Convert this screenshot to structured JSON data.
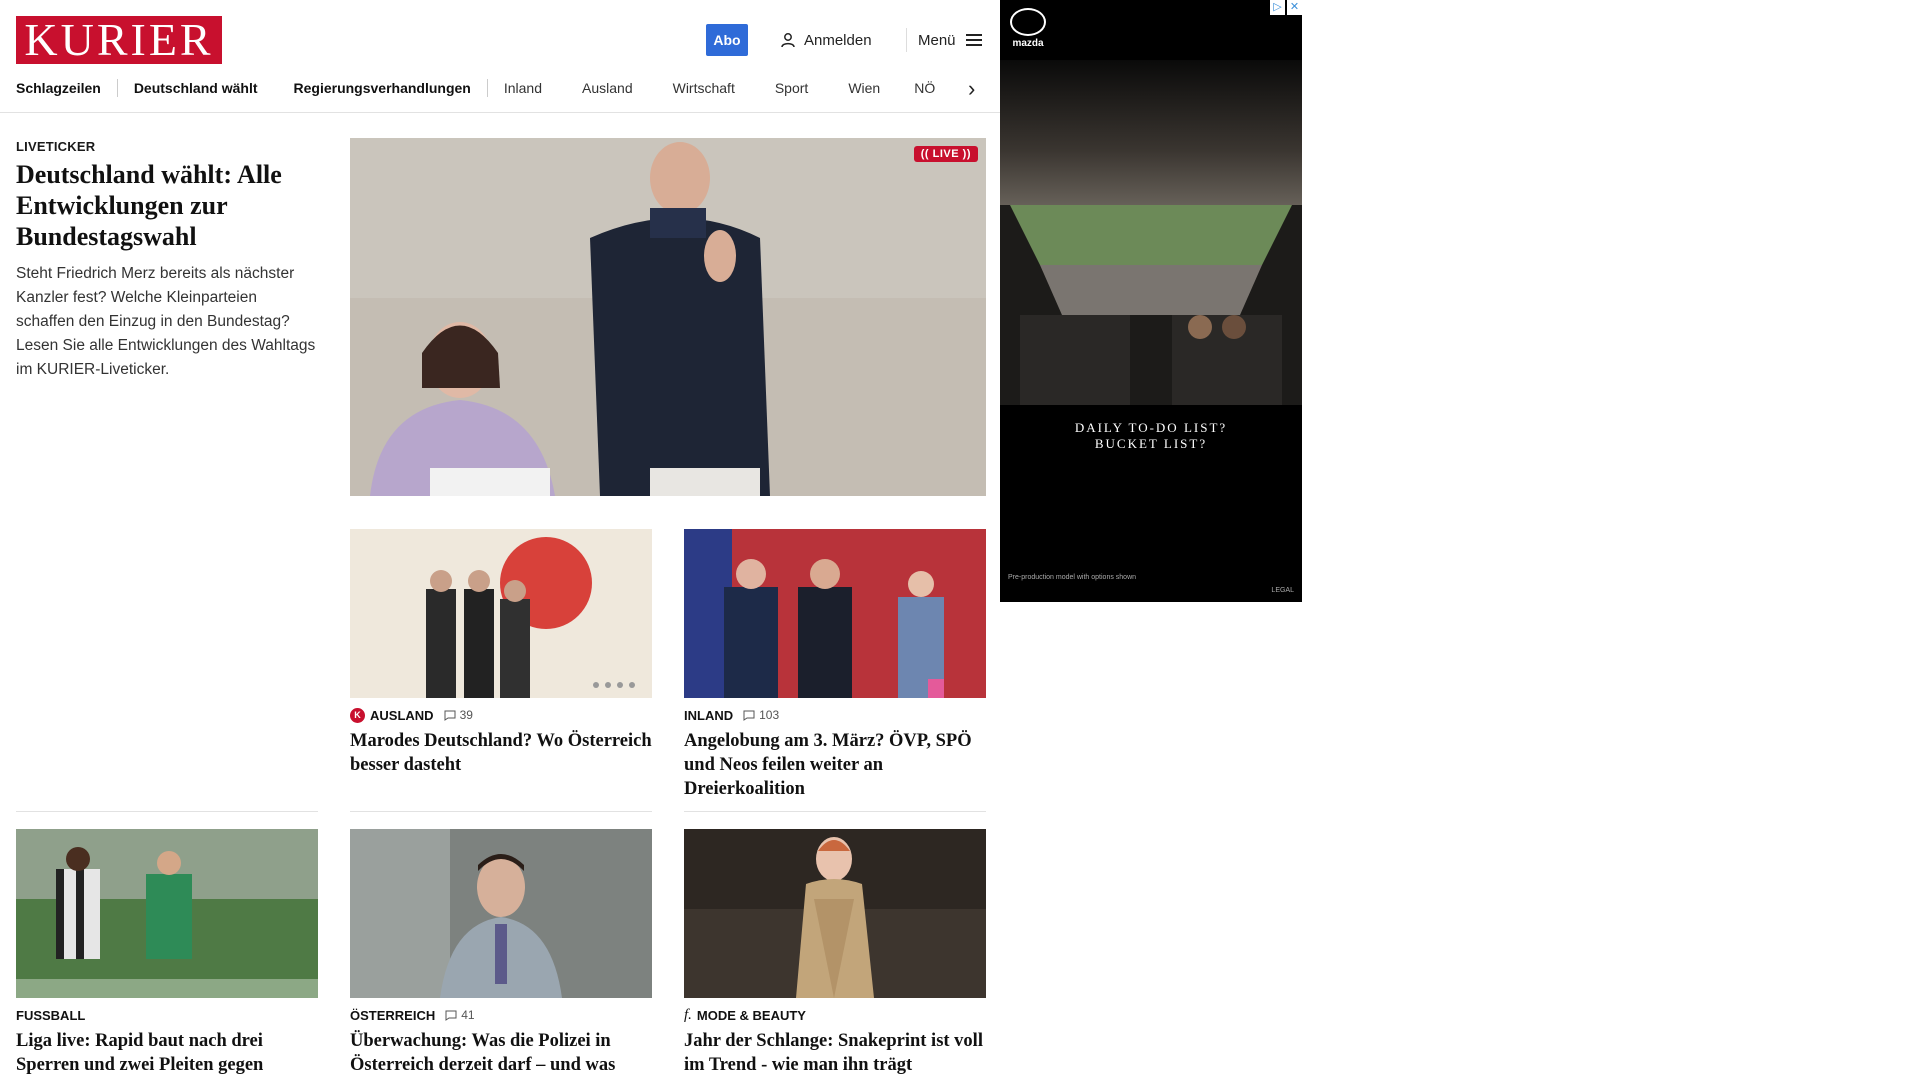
{
  "header": {
    "logo": "KURIER",
    "abo_label": "Abo",
    "login_label": "Anmelden",
    "menu_label": "Menü"
  },
  "nav": {
    "items": [
      "Schlagzeilen",
      "Deutschland wählt",
      "Regierungsverhandlungen",
      "Inland",
      "Ausland",
      "Wirtschaft",
      "Sport",
      "Wien",
      "NÖ"
    ]
  },
  "hero": {
    "kicker": "LIVETICKER",
    "title": "Deutschland wählt: Alle Entwicklungen zur Bundestagswahl",
    "lead": "Steht Friedrich Merz bereits als nächster Kanzler fest? Welche Kleinparteien schaffen den Einzug in den Bundestag? Lesen Sie alle Entwicklungen des Wahltags im KURIER-Liveticker.",
    "live_label": "LIVE"
  },
  "articles": [
    {
      "section": "AUSLAND",
      "comments": "39",
      "title": "Marodes Deutschland? Wo Österreich besser dasteht"
    },
    {
      "section": "INLAND",
      "comments": "103",
      "title": "Angelobung am 3. März? ÖVP, SPÖ und Neos feilen weiter an Dreierkoalition"
    },
    {
      "section": "FUSSBALL",
      "comments": "",
      "title": "Liga live: Rapid baut nach drei Sperren und zwei Pleiten gegen LASK um"
    },
    {
      "section": "ÖSTERREICH",
      "comments": "41",
      "title": "Überwachung: Was die Polizei in Österreich derzeit darf – und was nicht"
    },
    {
      "section": "MODE & BEAUTY",
      "comments": "",
      "title": "Jahr der Schlange: Snakeprint ist voll im Trend - wie man ihn trägt"
    }
  ],
  "ad": {
    "brand": "mazda",
    "tagline_1": "DAILY TO-DO LIST?",
    "tagline_2": "BUCKET LIST?",
    "fineprint": "Pre-production model with options shown",
    "legal": "LEGAL"
  },
  "colors": {
    "brand_red": "#c8102e",
    "abo_blue": "#2f6bd8"
  }
}
